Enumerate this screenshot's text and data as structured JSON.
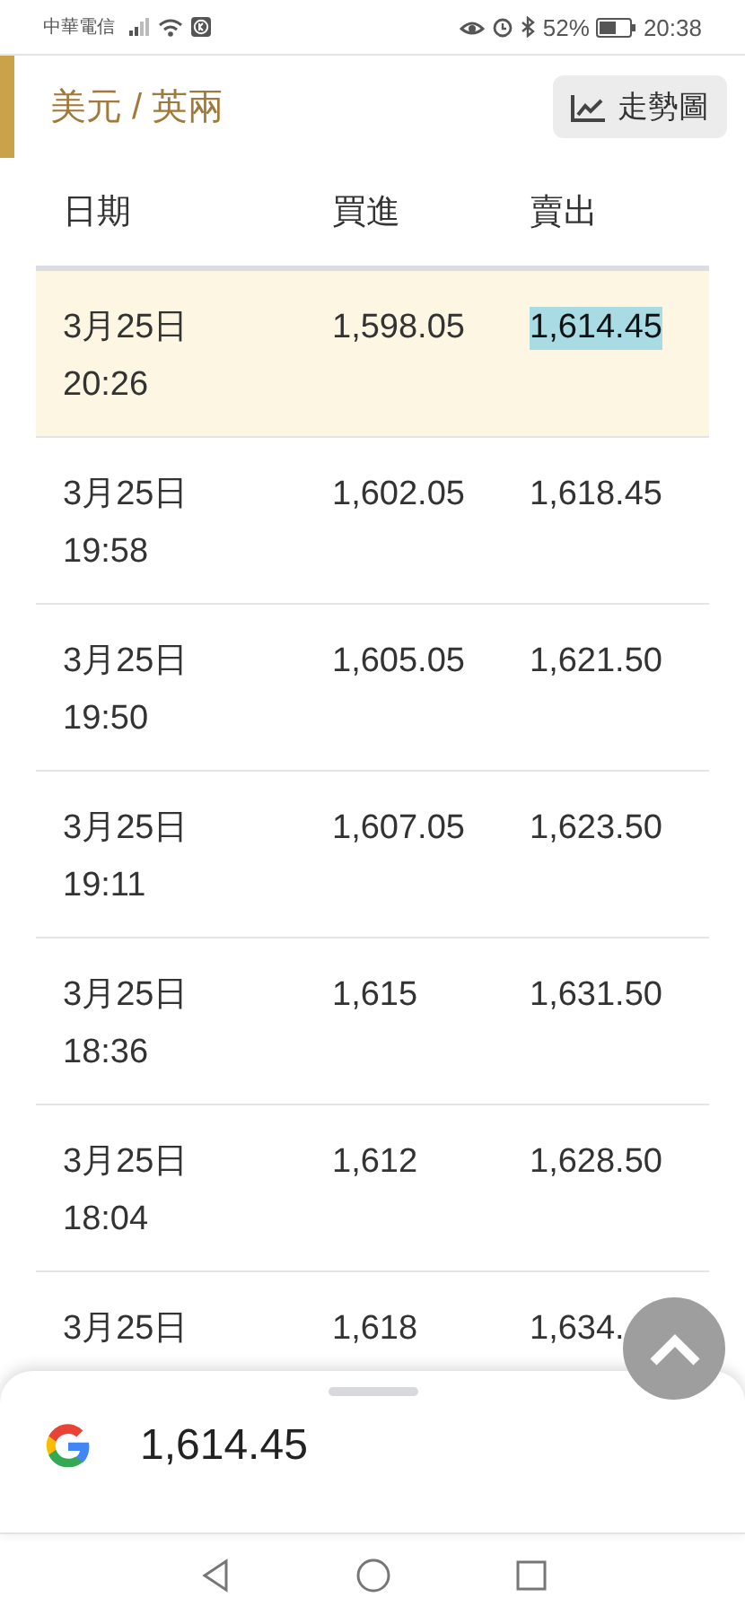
{
  "status_bar": {
    "carrier": "中華電信",
    "battery": "52%",
    "time": "20:38"
  },
  "header": {
    "title": "美元 / 英兩",
    "trend_button": "走勢圖"
  },
  "table": {
    "columns": [
      "日期",
      "買進",
      "賣出"
    ],
    "rows": [
      {
        "date": "3月25日",
        "time": "20:26",
        "buy": "1,598.05",
        "sell": "1,614.45",
        "selected": true,
        "sell_highlighted": true
      },
      {
        "date": "3月25日",
        "time": "19:58",
        "buy": "1,602.05",
        "sell": "1,618.45",
        "selected": false,
        "sell_highlighted": false
      },
      {
        "date": "3月25日",
        "time": "19:50",
        "buy": "1,605.05",
        "sell": "1,621.50",
        "selected": false,
        "sell_highlighted": false
      },
      {
        "date": "3月25日",
        "time": "19:11",
        "buy": "1,607.05",
        "sell": "1,623.50",
        "selected": false,
        "sell_highlighted": false
      },
      {
        "date": "3月25日",
        "time": "18:36",
        "buy": "1,615",
        "sell": "1,631.50",
        "selected": false,
        "sell_highlighted": false
      },
      {
        "date": "3月25日",
        "time": "18:04",
        "buy": "1,612",
        "sell": "1,628.50",
        "selected": false,
        "sell_highlighted": false
      },
      {
        "date": "3月25日",
        "buy": "1,618",
        "sell": "1,634.",
        "selected": false,
        "sell_highlighted": false
      }
    ]
  },
  "bottom_sheet": {
    "result": "1,614.45"
  }
}
